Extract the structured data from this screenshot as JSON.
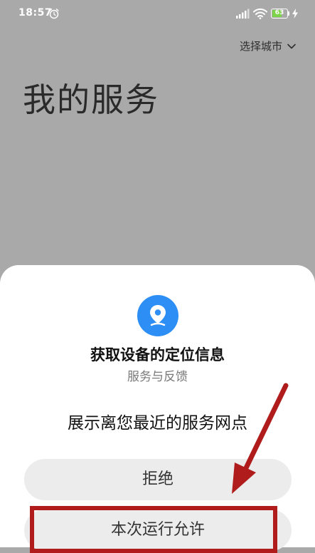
{
  "status_bar": {
    "time": "18:57",
    "battery_level": "63",
    "icons": [
      "alarm-icon",
      "signal-icon",
      "wifi-icon",
      "battery-icon",
      "charging-bolt-icon"
    ]
  },
  "header": {
    "city_selector_label": "选择城市",
    "city_selector_icon": "chevron-down-icon",
    "page_title": "我的服务"
  },
  "permission_dialog": {
    "icon": "location-pin-icon",
    "title": "获取设备的定位信息",
    "subtitle": "服务与反馈",
    "description": "展示离您最近的服务网点",
    "deny_label": "拒绝",
    "allow_once_label": "本次运行允许"
  },
  "annotation": {
    "color": "#b01c1c",
    "target": "allow_once_label"
  },
  "colors": {
    "backdrop": "#a9a9a9",
    "accent_blue": "#2d8ef5",
    "button_bg": "#ececec"
  }
}
